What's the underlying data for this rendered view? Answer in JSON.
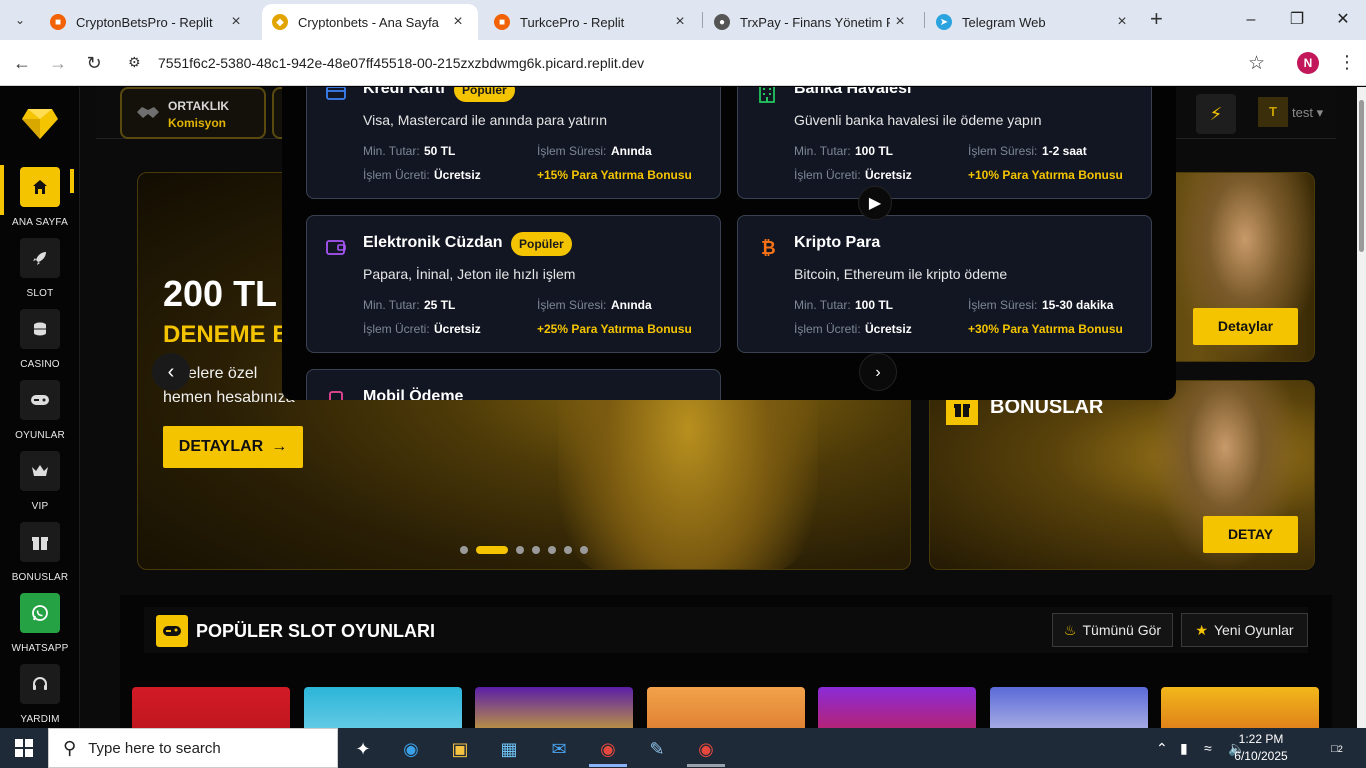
{
  "browser": {
    "tabs": [
      {
        "title": "CryptonBetsPro - Replit",
        "active": false
      },
      {
        "title": "Cryptonbets - Ana Sayfa",
        "active": true
      },
      {
        "title": "TurkcePro - Replit",
        "active": false
      },
      {
        "title": "TrxPay - Finans Yönetim Panel",
        "active": false
      },
      {
        "title": "Telegram Web",
        "active": false
      }
    ],
    "url": "7551f6c2-5380-48c1-942e-48e07ff45518-00-215zxzbdwmg6k.picard.replit.dev",
    "profile_initial": "N"
  },
  "sidebar": {
    "items": [
      {
        "label": "ANA SAYFA",
        "icon": "home-icon"
      },
      {
        "label": "SLOT",
        "icon": "rocket-icon"
      },
      {
        "label": "CASINO",
        "icon": "coins-icon"
      },
      {
        "label": "OYUNLAR",
        "icon": "gamepad-icon"
      },
      {
        "label": "VIP",
        "icon": "crown-icon"
      },
      {
        "label": "BONUSLAR",
        "icon": "gift-icon"
      },
      {
        "label": "WHATSAPP",
        "icon": "whatsapp-icon"
      },
      {
        "label": "YARDIM",
        "icon": "headset-icon"
      }
    ]
  },
  "topbar": {
    "partner_title": "ORTAKLIK",
    "partner_sub": "Komisyon",
    "user_initial": "T",
    "username": "test"
  },
  "hero": {
    "title": "200 TL",
    "subtitle": "DENEME B",
    "line1": "i üyelere özel",
    "line2": "hemen hesabınıza",
    "button": "DETAYLAR"
  },
  "cards": {
    "detail_button": "Detaylar",
    "bonus_title": "BONUSLAR",
    "bonus_button": "DETAY"
  },
  "payments": {
    "labels": {
      "min": "Min. Tutar:",
      "time": "İşlem Süresi:",
      "fee": "İşlem Ücreti:"
    },
    "methods": [
      {
        "name": "Kredi Kartı",
        "badge": "Popüler",
        "desc": "Visa, Mastercard ile anında para yatırın",
        "min": "50 TL",
        "time": "Anında",
        "fee": "Ücretsiz",
        "bonus": "+15% Para Yatırma Bonusu",
        "icon": "credit-card-icon"
      },
      {
        "name": "Banka Havalesi",
        "badge": "",
        "desc": "Güvenli banka havalesi ile ödeme yapın",
        "min": "100 TL",
        "time": "1-2 saat",
        "fee": "Ücretsiz",
        "bonus": "+10% Para Yatırma Bonusu",
        "icon": "bank-icon"
      },
      {
        "name": "Elektronik Cüzdan",
        "badge": "Popüler",
        "desc": "Papara, İninal, Jeton ile hızlı işlem",
        "min": "25 TL",
        "time": "Anında",
        "fee": "Ücretsiz",
        "bonus": "+25% Para Yatırma Bonusu",
        "icon": "wallet-icon"
      },
      {
        "name": "Kripto Para",
        "badge": "",
        "desc": "Bitcoin, Ethereum ile kripto ödeme",
        "min": "100 TL",
        "time": "15-30 dakika",
        "fee": "Ücretsiz",
        "bonus": "+30% Para Yatırma Bonusu",
        "icon": "bitcoin-icon"
      },
      {
        "name": "Mobil Ödeme",
        "icon": "mobile-icon"
      }
    ]
  },
  "slots": {
    "title": "POPÜLER SLOT OYUNLARI",
    "all_button": "Tümünü Gör",
    "new_button": "Yeni Oyunlar"
  },
  "taskbar": {
    "search_placeholder": "Type here to search",
    "time": "1:22 PM",
    "date": "6/10/2025",
    "notifications": "2"
  },
  "colors": {
    "accent": "#f5c400",
    "card_bg": "#111622",
    "popular_badge": "#f5c400"
  }
}
